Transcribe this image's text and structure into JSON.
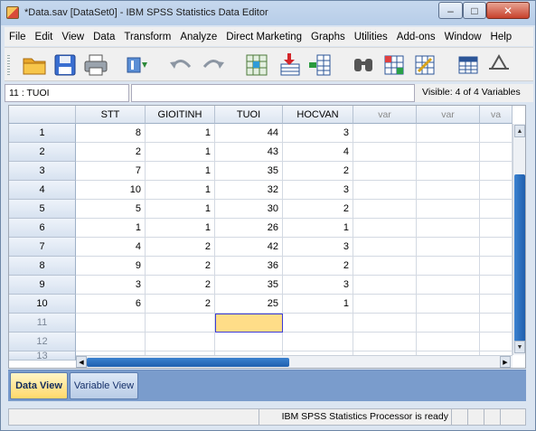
{
  "window": {
    "title": "*Data.sav [DataSet0] - IBM SPSS Statistics Data Editor"
  },
  "menu": [
    "File",
    "Edit",
    "View",
    "Data",
    "Transform",
    "Analyze",
    "Direct Marketing",
    "Graphs",
    "Utilities",
    "Add-ons",
    "Window",
    "Help"
  ],
  "toolbar": {
    "icons": [
      "open-folder-icon",
      "save-icon",
      "print-icon",
      "dialog-recall-icon",
      "undo-icon",
      "redo-icon",
      "goto-case-icon",
      "insert-cases-icon",
      "insert-variable-icon",
      "find-icon",
      "split-file-icon",
      "weight-cases-icon",
      "select-cases-icon",
      "value-labels-icon"
    ]
  },
  "cell_editor": {
    "cell_ref": "11 : TUOI",
    "value": "",
    "visible_label": "Visible: 4 of 4 Variables"
  },
  "grid": {
    "columns": [
      "STT",
      "GIOITINH",
      "TUOI",
      "HOCVAN",
      "var",
      "var",
      "va"
    ],
    "rows": [
      {
        "num": "1",
        "cells": [
          "8",
          "1",
          "44",
          "3"
        ]
      },
      {
        "num": "2",
        "cells": [
          "2",
          "1",
          "43",
          "4"
        ]
      },
      {
        "num": "3",
        "cells": [
          "7",
          "1",
          "35",
          "2"
        ]
      },
      {
        "num": "4",
        "cells": [
          "10",
          "1",
          "32",
          "3"
        ]
      },
      {
        "num": "5",
        "cells": [
          "5",
          "1",
          "30",
          "2"
        ]
      },
      {
        "num": "6",
        "cells": [
          "1",
          "1",
          "26",
          "1"
        ]
      },
      {
        "num": "7",
        "cells": [
          "4",
          "2",
          "42",
          "3"
        ]
      },
      {
        "num": "8",
        "cells": [
          "9",
          "2",
          "36",
          "2"
        ]
      },
      {
        "num": "9",
        "cells": [
          "3",
          "2",
          "35",
          "3"
        ]
      },
      {
        "num": "10",
        "cells": [
          "6",
          "2",
          "25",
          "1"
        ]
      },
      {
        "num": "11",
        "cells": [
          "",
          "",
          "",
          ""
        ]
      },
      {
        "num": "12",
        "cells": [
          "",
          "",
          "",
          ""
        ]
      },
      {
        "num": "13",
        "cells": [
          "",
          "",
          "",
          ""
        ]
      }
    ]
  },
  "tabs": {
    "data_view": "Data View",
    "variable_view": "Variable View"
  },
  "status": {
    "text": "IBM SPSS Statistics Processor is ready"
  }
}
